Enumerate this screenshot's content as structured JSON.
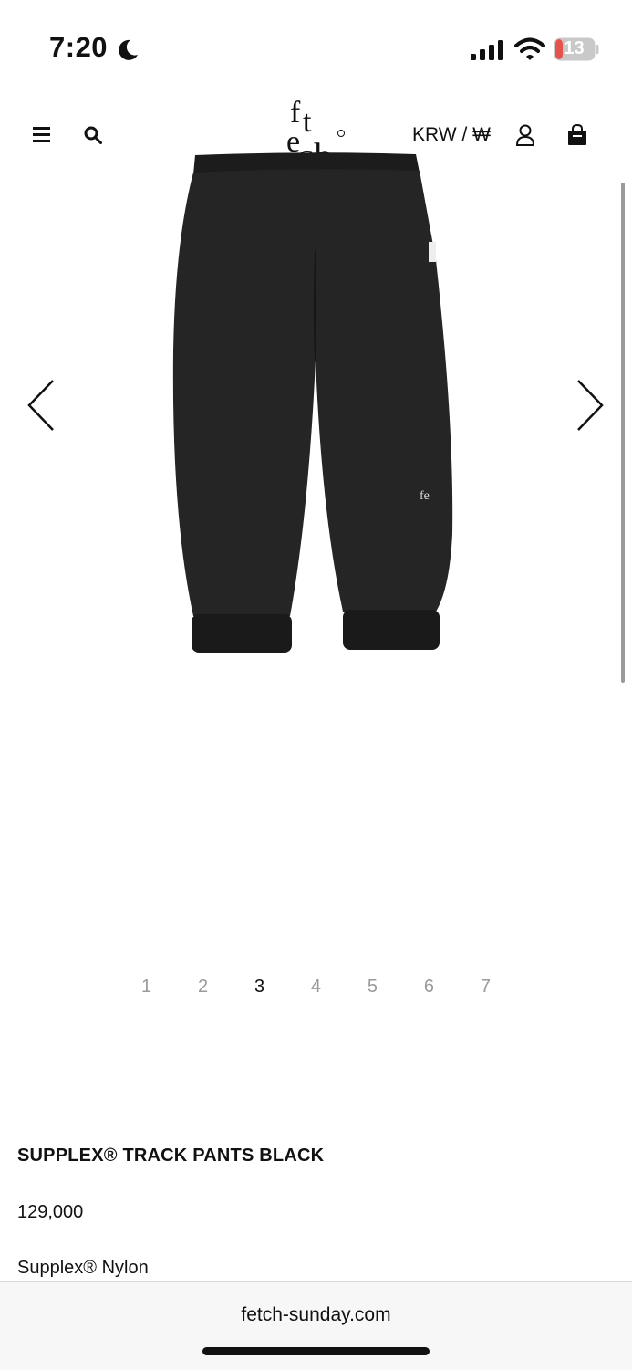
{
  "status_bar": {
    "time": "7:20",
    "battery": "13",
    "icons": [
      "moon-icon",
      "signal-icon",
      "wifi-icon",
      "battery-icon"
    ]
  },
  "header": {
    "logo": "fetch",
    "currency": "KRW / ₩",
    "icons": [
      "menu-icon",
      "search-icon",
      "user-icon",
      "shopping-bag-icon"
    ]
  },
  "gallery": {
    "pages": [
      "1",
      "2",
      "3",
      "4",
      "5",
      "6",
      "7"
    ],
    "active_page": "3",
    "icons": [
      "chevron-left-icon",
      "chevron-right-icon"
    ]
  },
  "product": {
    "title": "SUPPLEX® TRACK PANTS BLACK",
    "price": "129,000",
    "material": "Supplex® Nylon"
  },
  "browser": {
    "url": "fetch-sunday.com"
  },
  "colors": {
    "text": "#111111",
    "muted": "#9a9a9a",
    "battery_low": "#e5534b"
  }
}
